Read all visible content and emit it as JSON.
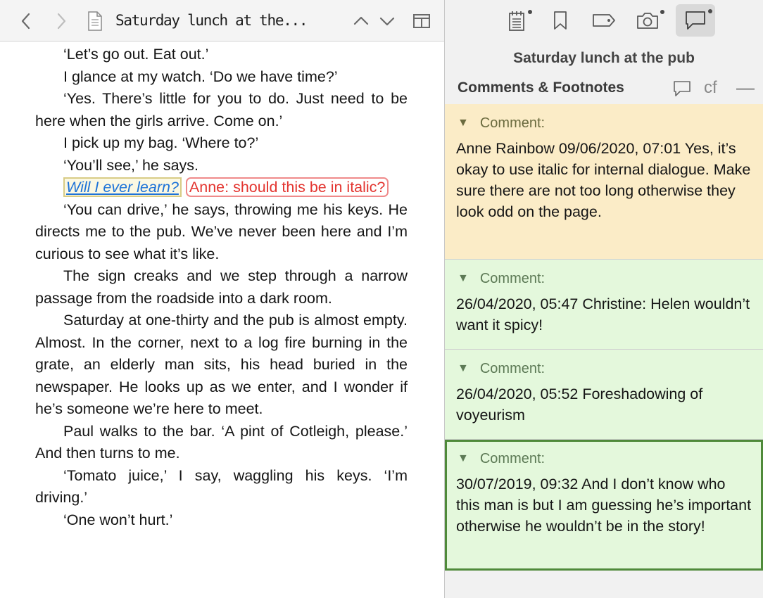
{
  "editor": {
    "document_title": "Saturday lunch at the...",
    "paragraphs": [
      "‘Let’s go out. Eat out.’",
      "I glance at my watch. ‘Do we have time?’",
      "‘Yes. There’s little for you to do. Just need to be here when the girls arrive. Come on.’",
      "I pick up my bag. ‘Where to?’",
      "‘You’ll see,’ he says.",
      "‘You can drive,’ he says, throwing me his keys. He directs me to the pub. We’ve never been here and I’m curious to see what it’s like.",
      "The sign creaks and we step through a narrow passage from the roadside into a dark room.",
      "Saturday at one-thirty and the pub is almost empty. Almost. In the corner, next to a log fire burning in the grate, an elderly man sits, his head buried in the newspaper. He looks up as we enter, and I wonder if he’s someone we’re here to meet.",
      "Paul walks to the bar. ‘A pint of Cotleigh, please.’ And then turns to me.",
      "‘Tomato juice,’ I say, waggling his keys. ‘I’m driving.’",
      "‘One won’t hurt.’"
    ],
    "annotated_text": "Will I ever learn?",
    "inline_comment": "Anne: should this be in italic?"
  },
  "inspector": {
    "document_title": "Saturday lunch at the pub",
    "section_title": "Comments & Footnotes",
    "footnote_label": "cf",
    "collapse_label": "—",
    "comments": [
      {
        "label": "Comment:",
        "text": "Anne Rainbow 09/06/2020, 07:01 Yes, it’s okay to use italic for internal dialogue. Make sure there are not too long otherwise they look odd on the page.",
        "color": "#fbecc7"
      },
      {
        "label": "Comment:",
        "text": "26/04/2020, 05:47 Christine: Helen wouldn’t want it spicy!",
        "color": "#e4f8dc"
      },
      {
        "label": "Comment:",
        "text": "26/04/2020, 05:52 Foreshadowing of voyeurism",
        "color": "#e4f8dc"
      },
      {
        "label": "Comment:",
        "text": "30/07/2019, 09:32 And I don’t know who this man is but I am guessing he’s important otherwise he wouldn’t be in the story!",
        "color": "#e4f8dc"
      }
    ]
  },
  "colors": {
    "accent_link": "#1e73d8",
    "inline_comment": "#e3342f",
    "selected_border": "#4f8a3a"
  },
  "icons": [
    "chevron-left-icon",
    "chevron-right-icon",
    "document-icon",
    "chevron-up-icon",
    "chevron-down-icon",
    "split-view-icon",
    "notepad-icon",
    "bookmark-icon",
    "tag-icon",
    "camera-icon",
    "comment-bubble-icon"
  ]
}
